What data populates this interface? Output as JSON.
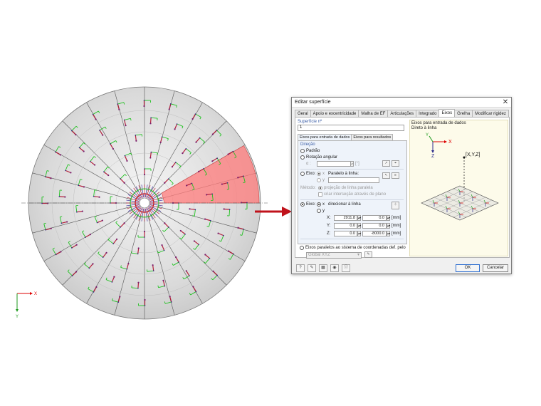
{
  "viewport": {
    "axis_x_label": "X",
    "axis_y_label": "Y"
  },
  "dialog": {
    "title": "Editar superfície",
    "close_glyph": "✕",
    "tabs": [
      "Geral",
      "Apoio e excentricidade",
      "Malha de EF",
      "Articulações",
      "Integrado",
      "Eixos",
      "Grelha",
      "Modificar rigidez"
    ],
    "active_tab": "Eixos",
    "surface_label": "Superfície nº",
    "surface_value": "1",
    "subtabs": [
      "Eixos para entrada de dados",
      "Eixos para resultados"
    ],
    "direction_label": "Direção",
    "radio_default": "Padrão",
    "radio_rotation": "Rotação angular",
    "alpha_label": "α :",
    "alpha_unit": "[°]",
    "radio_axis": "Eixo:",
    "axis_x": "x",
    "axis_y": "y",
    "parallel_line": "Paralelo à linha:",
    "method_label": "Método:",
    "method_option1": "projeção de linha paralela",
    "method_option2": "criar interseção através de plano",
    "radio_axis2": "Eixo:",
    "axis2_x": "x",
    "axis2_y": "y",
    "direct_to_line": "direcionar à linha",
    "coord_x_label": "X:",
    "coord_y_label": "Y:",
    "coord_z_label": "Z:",
    "coord_x": [
      "2911.8",
      "0.0"
    ],
    "coord_y": [
      "0.0",
      "0.0"
    ],
    "coord_z": [
      "0.0",
      "-8000.0"
    ],
    "unit_mm": "[mm]",
    "radio_parallel_cs": "Eixos paralelos ao sistema de coordenadas def. pelo",
    "cs_select": "Global XYZ",
    "info_line1": "Eixos para entrada de dados",
    "info_line2": "Direto à linha",
    "preview_point_label": "[X,Y,Z]",
    "preview_axis_x": "X",
    "preview_axis_y": "Y",
    "preview_axis_z": "Z",
    "ok_label": "OK",
    "cancel_label": "Cancelar"
  },
  "colors": {
    "dialog_accent": "#3b5ea6",
    "highlight_sector": "#ff7b7b",
    "arrow": "#c0121b",
    "axis_green": "#22c122",
    "axis_navy": "#2a2a8a"
  }
}
